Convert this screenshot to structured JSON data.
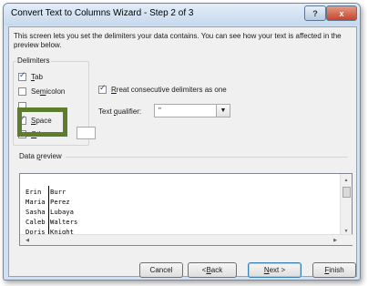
{
  "window": {
    "title": "Convert Text to Columns Wizard - Step 2 of 3",
    "help_label": "?",
    "close_label": "x"
  },
  "description": "This screen lets you set the delimiters your data contains.  You can see how your text is affected in the preview below.",
  "delimiters": {
    "legend": "Delimiters",
    "tab": {
      "key": "T",
      "rest": "ab",
      "checked": true
    },
    "semicolon": {
      "pre": "Se",
      "key": "m",
      "rest": "icolon",
      "checked": false
    },
    "comma": {
      "label": "",
      "checked": false
    },
    "space": {
      "key": "S",
      "rest": "pace",
      "checked": true
    },
    "other": {
      "key": "O",
      "rest": "ther:",
      "checked": false,
      "value": ""
    }
  },
  "treat_consecutive": {
    "key": "R",
    "rest_after": "reat consecutive delimiters as one",
    "checked": true
  },
  "text_qualifier": {
    "pre": "Text ",
    "key": "q",
    "rest": "ualifier:",
    "value": "\""
  },
  "data_preview": {
    "label_pre": "Data ",
    "label_key": "p",
    "label_rest": "review",
    "rows": [
      {
        "first": "Erin",
        "last": "Burr"
      },
      {
        "first": "Maria",
        "last": "Perez"
      },
      {
        "first": "Sasha",
        "last": "Lubaya"
      },
      {
        "first": "Caleb",
        "last": "Walters"
      },
      {
        "first": "Doris",
        "last": "Knight"
      }
    ]
  },
  "buttons": {
    "cancel": "Cancel",
    "back": {
      "pre": "< ",
      "key": "B",
      "rest": "ack"
    },
    "next": {
      "key": "N",
      "rest": "ext >"
    },
    "finish": {
      "key": "F",
      "rest": "inish"
    }
  },
  "colors": {
    "highlight": "#5d7d2c",
    "title_bar": "#cfe0f2"
  }
}
